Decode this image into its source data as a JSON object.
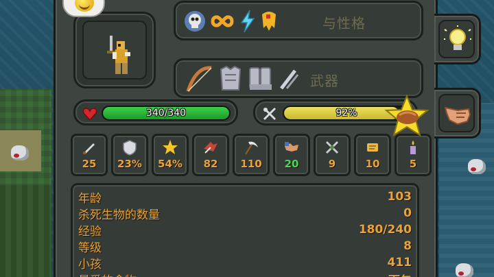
{
  "trait_label": "与性格",
  "equipment_label": "武器",
  "health": {
    "text": "340/340",
    "fraction": 1.0
  },
  "food": {
    "text": "92%",
    "fraction": 0.92
  },
  "stats": [
    {
      "icon": "damage-sword-icon",
      "value": "25"
    },
    {
      "icon": "armor-shield-icon",
      "value": "23%"
    },
    {
      "icon": "critical-star-icon",
      "value": "54%"
    },
    {
      "icon": "attack-speed-icon",
      "value": "82"
    },
    {
      "icon": "range-scythe-icon",
      "value": "110"
    },
    {
      "icon": "diplomacy-handshake-icon",
      "value": "20",
      "color": "#4ed35b"
    },
    {
      "icon": "warfare-crossed-swords-icon",
      "value": "9"
    },
    {
      "icon": "stewardship-scroll-icon",
      "value": "10"
    },
    {
      "icon": "intelligence-candle-icon",
      "value": "5"
    }
  ],
  "info_rows": [
    {
      "label": "年龄",
      "value": "103"
    },
    {
      "label": "杀死生物的数量",
      "value": "0"
    },
    {
      "label": "经验",
      "value": "180/240"
    },
    {
      "label": "等级",
      "value": "8"
    },
    {
      "label": "小孩",
      "value": "411"
    },
    {
      "label": "最爱的食物",
      "value": "面包"
    }
  ],
  "colors": {
    "accent_orange": "#e8a33a",
    "health_green": "#2fbf3c",
    "food_yellow": "#d9cc44",
    "panel": "#3e4540"
  }
}
